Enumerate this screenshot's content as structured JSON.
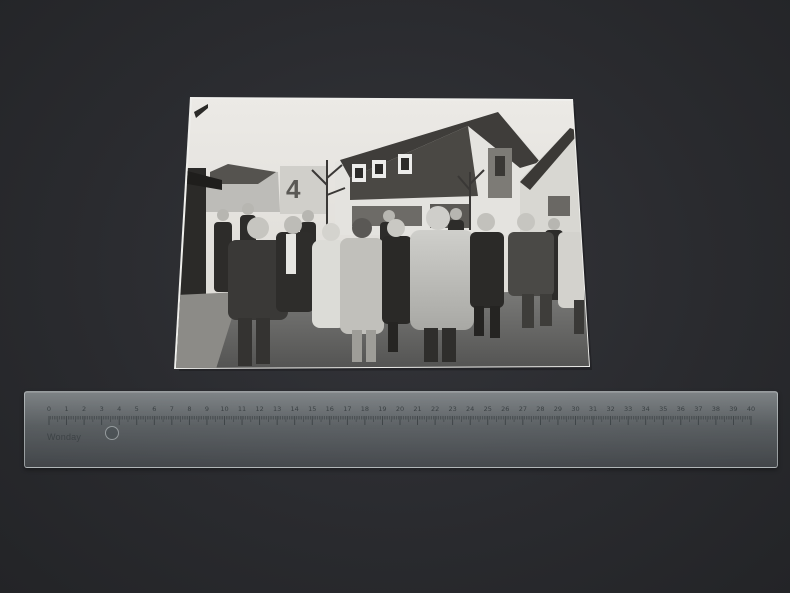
{
  "ruler": {
    "brand": "Wonday",
    "unit": "cm",
    "min": 0,
    "max": 40,
    "numbers": [
      "0",
      "1",
      "2",
      "3",
      "4",
      "5",
      "6",
      "7",
      "8",
      "9",
      "10",
      "11",
      "12",
      "13",
      "14",
      "15",
      "16",
      "17",
      "18",
      "19",
      "20",
      "21",
      "22",
      "23",
      "24",
      "25",
      "26",
      "27",
      "28",
      "29",
      "30",
      "31",
      "32",
      "33",
      "34",
      "35",
      "36",
      "37",
      "38",
      "39",
      "40"
    ]
  },
  "photo": {
    "sign_text": "4"
  },
  "colors": {
    "background": "#2b2c30",
    "photo_border": "#f2f2ef",
    "ruler_tint": "#b9c2c4"
  }
}
